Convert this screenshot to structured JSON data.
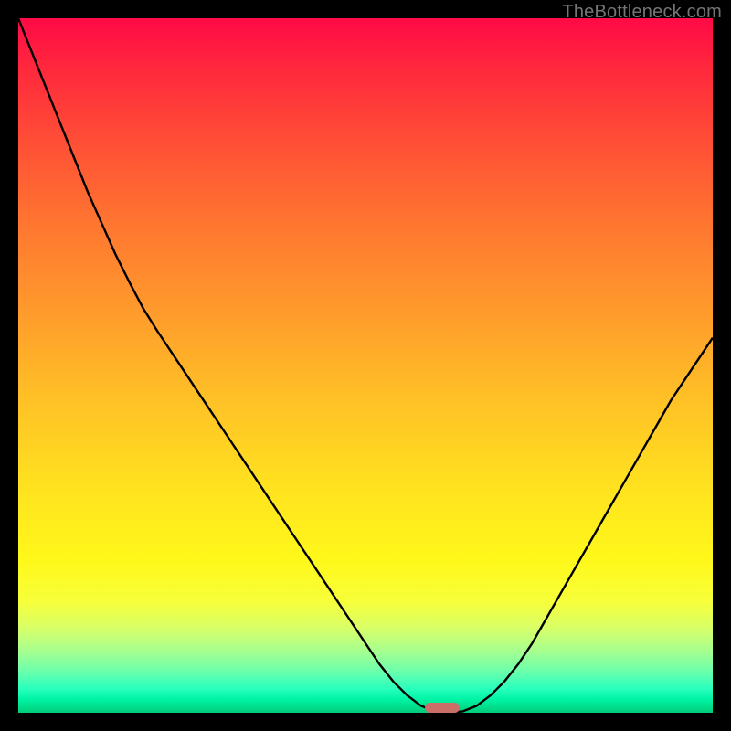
{
  "watermark": "TheBottleneck.com",
  "colors": {
    "frame_bg": "#000000",
    "watermark_text": "#757575",
    "curve_stroke": "#000000",
    "marker_fill": "#cb6e67"
  },
  "chart_data": {
    "type": "line",
    "title": "",
    "xlabel": "",
    "ylabel": "",
    "xlim": [
      0,
      100
    ],
    "ylim": [
      0,
      100
    ],
    "grid": false,
    "legend": false,
    "x": [
      0,
      2,
      4,
      6,
      8,
      10,
      12,
      14,
      16,
      18,
      20,
      22,
      24,
      26,
      28,
      30,
      32,
      34,
      36,
      38,
      40,
      42,
      44,
      46,
      48,
      50,
      52,
      54,
      56,
      58,
      60,
      62,
      64,
      66,
      68,
      70,
      72,
      74,
      76,
      78,
      80,
      82,
      84,
      86,
      88,
      90,
      92,
      94,
      96,
      98,
      100
    ],
    "values": [
      100.0,
      95.0,
      90.0,
      85.0,
      80.0,
      75.0,
      70.5,
      66.0,
      62.0,
      58.2,
      55.0,
      52.0,
      49.0,
      46.0,
      43.0,
      40.0,
      37.0,
      34.0,
      31.0,
      28.0,
      25.0,
      22.0,
      19.0,
      16.0,
      13.0,
      10.0,
      7.0,
      4.5,
      2.5,
      1.0,
      0.2,
      0.0,
      0.2,
      1.0,
      2.5,
      4.5,
      7.0,
      10.0,
      13.5,
      17.0,
      20.5,
      24.0,
      27.5,
      31.0,
      34.5,
      38.0,
      41.5,
      45.0,
      48.0,
      51.0,
      54.0
    ],
    "marker": {
      "x": 61,
      "y": 0,
      "w": 5,
      "h": 1.5
    },
    "gradient_stops": [
      {
        "pct": 0,
        "hex": "#ff0a46"
      },
      {
        "pct": 18,
        "hex": "#ff4f36"
      },
      {
        "pct": 42,
        "hex": "#ff9a2c"
      },
      {
        "pct": 68,
        "hex": "#ffe31f"
      },
      {
        "pct": 88,
        "hex": "#d6ff6a"
      },
      {
        "pct": 96,
        "hex": "#2affbd"
      },
      {
        "pct": 100,
        "hex": "#00cc7a"
      }
    ]
  }
}
